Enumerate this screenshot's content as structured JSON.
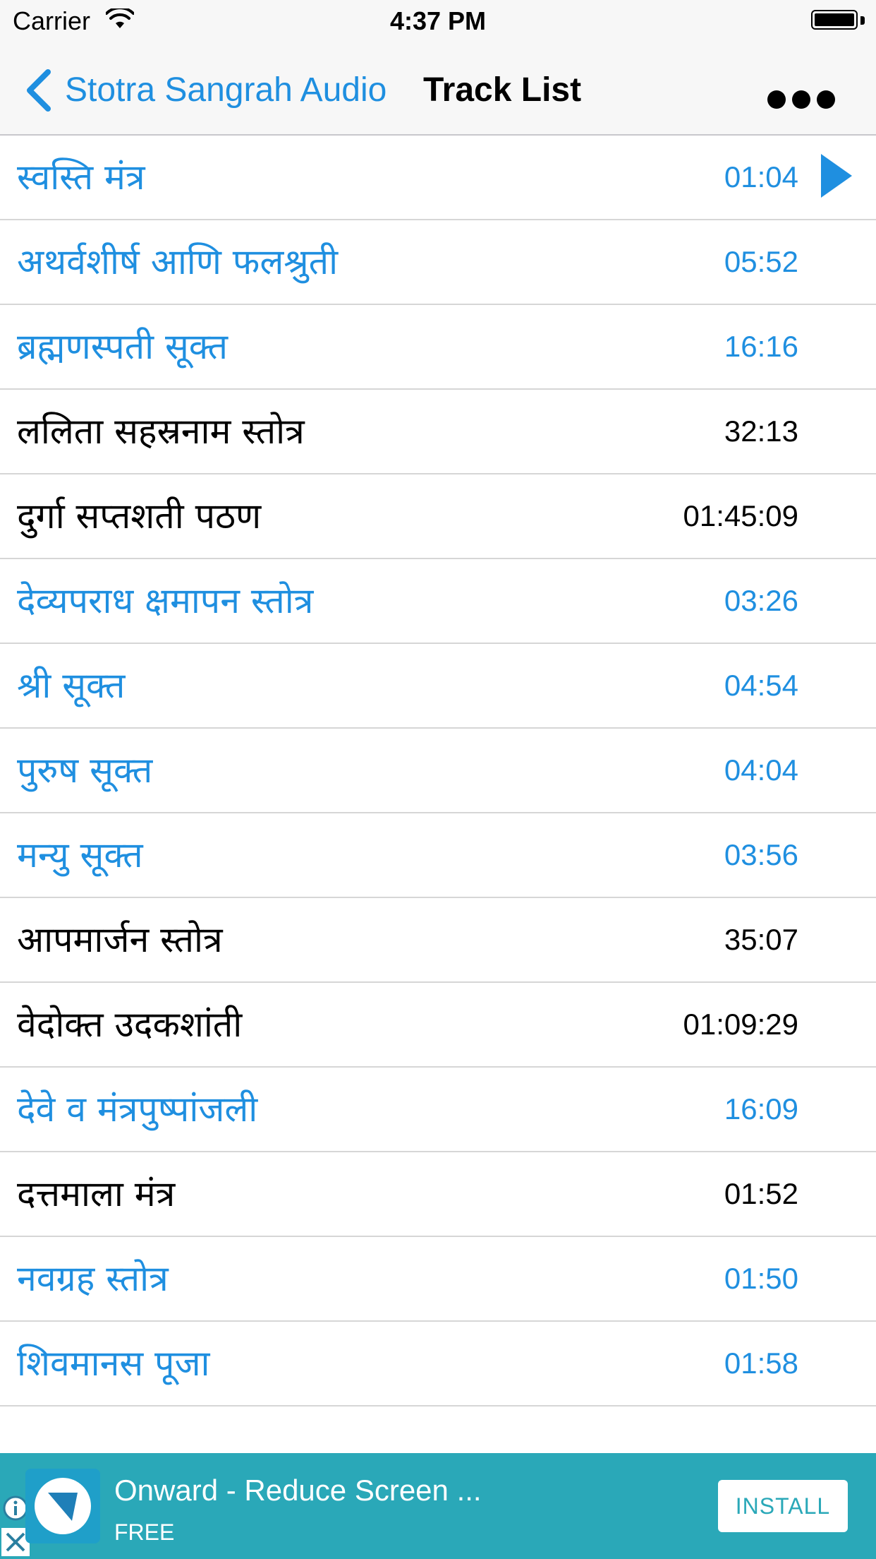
{
  "status_bar": {
    "carrier": "Carrier",
    "time": "4:37 PM"
  },
  "nav": {
    "back_label": "Stotra Sangrah Audio",
    "title": "Track List",
    "more_icon": "ellipsis-icon"
  },
  "colors": {
    "accent": "#1f8fe0",
    "text": "#000000",
    "ad_background": "#2aa8b8"
  },
  "tracks": [
    {
      "title": "स्वस्ति मंत्र",
      "duration": "01:04",
      "state": "blue",
      "playing": true
    },
    {
      "title": "अथर्वशीर्ष  आणि फलश्रुती",
      "duration": "05:52",
      "state": "blue"
    },
    {
      "title": "ब्रह्मणस्पती सूक्त",
      "duration": "16:16",
      "state": "blue"
    },
    {
      "title": "ललिता सहस्रनाम स्तोत्र",
      "duration": "32:13",
      "state": "black"
    },
    {
      "title": "दुर्गा सप्तशती पठण",
      "duration": "01:45:09",
      "state": "black"
    },
    {
      "title": "देव्यपराध  क्षमापन स्तोत्र",
      "duration": "03:26",
      "state": "blue"
    },
    {
      "title": "श्री सूक्त",
      "duration": "04:54",
      "state": "blue"
    },
    {
      "title": "पुरुष सूक्त",
      "duration": "04:04",
      "state": "blue"
    },
    {
      "title": "मन्यु  सूक्त",
      "duration": "03:56",
      "state": "blue"
    },
    {
      "title": "आपमार्जन स्तोत्र",
      "duration": "35:07",
      "state": "black"
    },
    {
      "title": "वेदोक्त उदकशांती",
      "duration": "01:09:29",
      "state": "black"
    },
    {
      "title": "देवे व मंत्रपुष्पांजली",
      "duration": "16:09",
      "state": "blue"
    },
    {
      "title": "दत्तमाला मंत्र",
      "duration": "01:52",
      "state": "black"
    },
    {
      "title": "नवग्रह स्तोत्र",
      "duration": "01:50",
      "state": "blue"
    },
    {
      "title": "शिवमानस  पूजा",
      "duration": "01:58",
      "state": "blue"
    }
  ],
  "ad": {
    "title": "Onward - Reduce Screen ...",
    "price": "FREE",
    "install_label": "INSTALL"
  }
}
